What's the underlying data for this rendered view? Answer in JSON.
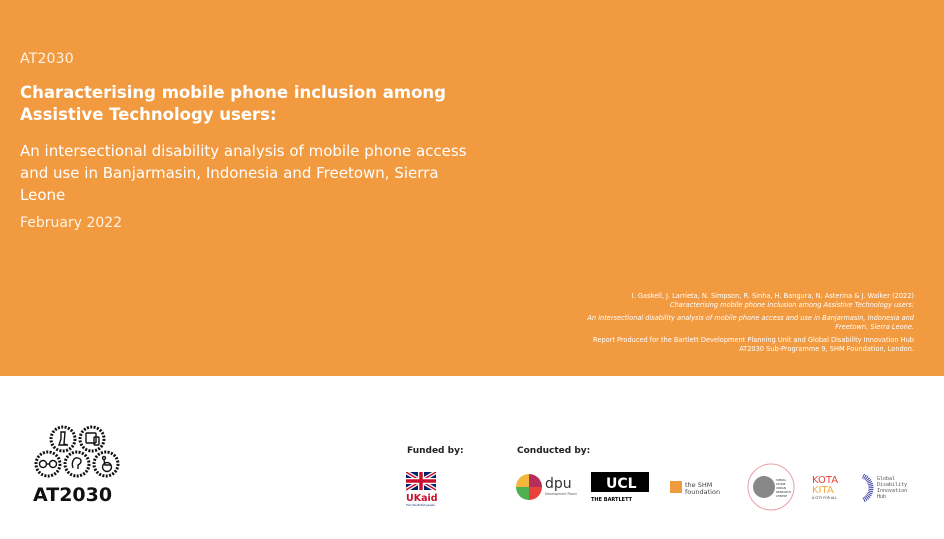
{
  "cover": {
    "series": "AT2030",
    "title": "Characterising mobile phone inclusion among Assistive Technology users:",
    "subtitle": "An intersectional disability analysis of mobile phone access and use in Banjarmasin, Indonesia and Freetown, Sierra Leone",
    "date": "February 2022",
    "colors": {
      "hero_background": "#f29a40",
      "text": "#ffffff"
    }
  },
  "citation": {
    "authors": "I. Gaskell, J. Larrieta, N. Simpson, R. Sinha, H. Bangura, N. Asterina & J. Walker",
    "year": "(2022)",
    "title_italic": "Characterising mobile phone inclusion among Assistive Technology users:",
    "subtitle_italic": "An intersectional disability analysis of mobile phone access and use in Banjarmasin, Indonesia and Freetown, Sierra Leone.",
    "report_note": "Report Produced for the Bartlett Development Planning Unit and Global Disability Innovation Hub AT2030 Sub-Programme 9, SHM Foundation, London."
  },
  "footer": {
    "programme_logo": {
      "label": "AT2030",
      "icons": [
        "prosthetic-leg-icon",
        "phone-tablet-icon",
        "glasses-icon",
        "hearing-aid-icon",
        "wheelchair-icon"
      ]
    },
    "funded_label": "Funded by:",
    "conducted_label": "Conducted by:",
    "funders": [
      {
        "name": "UK aid",
        "text": "UKaid",
        "tagline": "from the British people"
      }
    ],
    "partners": [
      {
        "name": "dpu",
        "text": "dpu",
        "tagline": "Development Planning Unit"
      },
      {
        "name": "UCL The Bartlett",
        "text": "UCL",
        "tagline": "THE BARTLETT"
      },
      {
        "name": "the SHM foundation",
        "line1": "the SHM",
        "line2": "foundation"
      },
      {
        "name": "Sierra Leone Urban Research Centre",
        "lines": [
          "SIERRA",
          "LEONE",
          "URBAN",
          "RESEARCH",
          "CENTRE"
        ]
      },
      {
        "name": "Kota Kita",
        "line1": "KOTA",
        "line2": "KITA",
        "tagline": "A CITY FOR ALL"
      },
      {
        "name": "Global Disability Innovation Hub",
        "lines": [
          "Global",
          "Disability",
          "Innovation",
          "Hub"
        ]
      }
    ]
  }
}
